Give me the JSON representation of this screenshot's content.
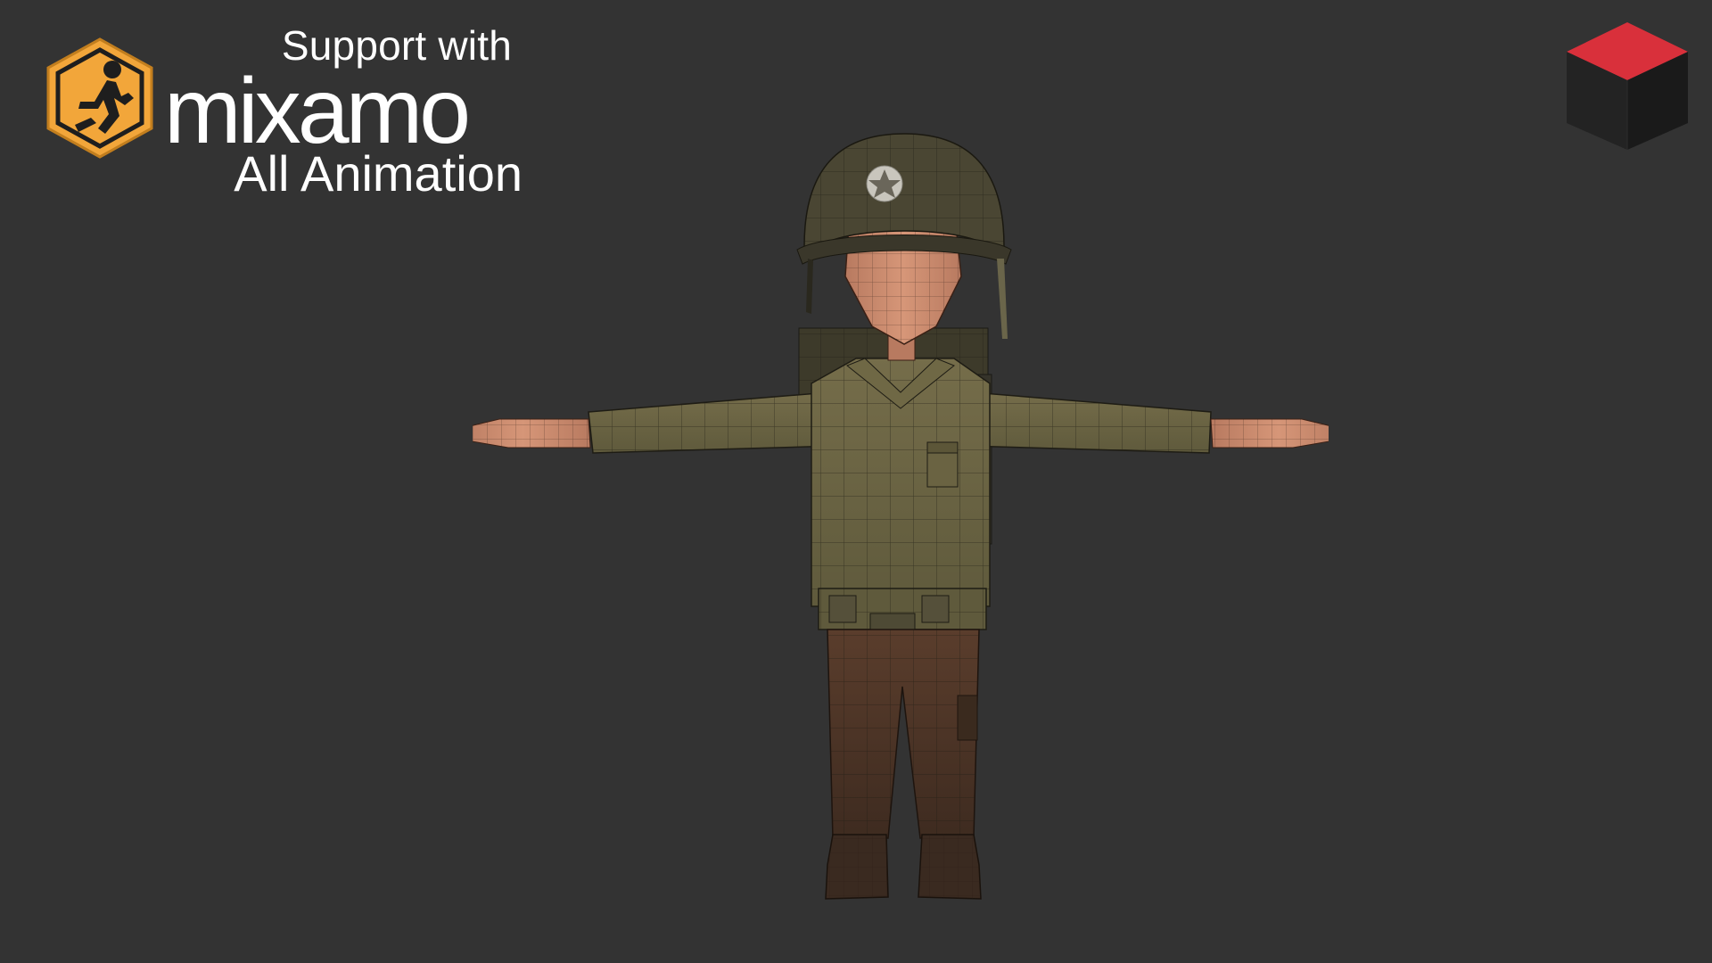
{
  "promo": {
    "support_text": "Support with",
    "brand_wordmark": "mixamo",
    "subtitle": "All Animation"
  },
  "studio_logo": {
    "caption_part1": "",
    "caption_part2": "",
    "top_color": "#d9303b",
    "side_color": "#1f1f1f"
  },
  "colors": {
    "background": "#333333",
    "mixamo_orange": "#f2a63a",
    "shirt": "#6b6444",
    "pants": "#4d3528",
    "skin": "#c8876a",
    "helmet": "#4a4633"
  },
  "icons": {
    "mixamo_logo": "running-figure-hexagon-icon",
    "studio_logo": "3d-cube-icon"
  }
}
